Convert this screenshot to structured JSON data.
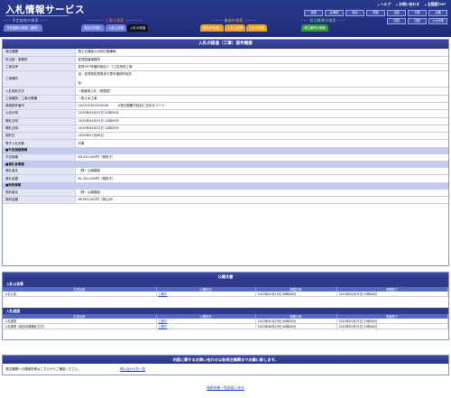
{
  "header": {
    "title": "入札情報サービス",
    "top_links": [
      "ヘルプ",
      "お問い合わせ",
      "全国版TOP"
    ],
    "regions_row1": [
      "全国",
      "北海道",
      "東北",
      "関東",
      "北陸",
      "中部",
      "近畿"
    ],
    "regions_row2": [
      "中国",
      "四国",
      "九州沖縄"
    ],
    "nav_groups": [
      {
        "label": "予定価格の検索",
        "tabs": [
          "予定価格の検索（通常）"
        ]
      },
      {
        "label": "工事の検索",
        "tabs": [
          "発注の見通し",
          "入札公告等",
          "入札の経過"
        ],
        "active": 2
      },
      {
        "label": "業務の検索",
        "tabs": [
          "発注の見通し",
          "入札公告等",
          "入札の経過"
        ]
      },
      {
        "label": "発注機関の検索",
        "tabs": [
          "発注機関の情報"
        ]
      }
    ]
  },
  "detail": {
    "title": "入札の経過（工事）案件概要",
    "rows": [
      {
        "label": "発注機関",
        "value": "国土交通省九州地方整備局"
      },
      {
        "label": "担当部・事務所",
        "value": "佐賀国道事務所"
      },
      {
        "label": "工事名称",
        "value": "佐賀497号福田地区5・7工区改良工事"
      },
      {
        "label": "工事場所",
        "value": "自：佐賀県佐賀県伊万里市福田町地先",
        "value2": "至："
      },
      {
        "label": "入札契約方式",
        "value": "一般競争入札（簡易型）"
      },
      {
        "label": "工事種別／工事の業種",
        "value": "一般土木工事"
      },
      {
        "label": "調達案件番号",
        "value": "202305300010006　　　※発注機関が独自に定めるコード"
      },
      {
        "label": "公告日時",
        "value": "2023年05月15日 07時30分"
      },
      {
        "label": "開札日時",
        "value": "2023年05月25日 12時00分"
      },
      {
        "label": "開札日時",
        "value": "2023年05月22日 14時33分"
      },
      {
        "label": "契約日",
        "value": "2023年07月06日"
      },
      {
        "label": "電子入札対象",
        "value": "対象"
      }
    ],
    "price_section": "■予定価格情報",
    "price_label": "予定価格",
    "price_value": "89,420,000円（税抜き）",
    "winner_section": "■落札者情報",
    "winner_label": "落札者名",
    "winner_value": "（株）山崎建設",
    "winner_amount_label": "落札金額",
    "winner_amount_value": "81,300,000円（税抜き）",
    "contract_section": "■契約情報",
    "contract_label": "契約者名",
    "contract_value": "（株）山崎建設",
    "contract_amount_label": "契約金額",
    "contract_amount_value": "89,050,000円（税込み）"
  },
  "attachments": {
    "title": "公開文書",
    "headers": [
      "文書名称",
      "公開状況",
      "掲載日時",
      "掲載終了"
    ],
    "group1_title": "入札公告等",
    "group1_rows": [
      {
        "name": "入札公告",
        "status": "公開中",
        "start": "2023年05月15日 08時00分",
        "end": "2023年05月31日 23時00分"
      }
    ],
    "group2_title": "入札経過",
    "group2_rows": [
      {
        "name": "入札調書",
        "status": "公開中",
        "start": "2023年05月29日 00時00分",
        "end": "2023年05月31日 23時00分"
      },
      {
        "name": "入札調書（総合評価落札方式）",
        "status": "公開中",
        "start": "2023年06月29日 00時00分",
        "end": "2023年05月31日 23時00分"
      }
    ]
  },
  "inquiry": {
    "title": "内容に関するお問い合わせは各発注機関までお願い致します。",
    "text": "発注機関への連絡先等はこちらからご確認ください。",
    "link": "問い合わせ先一覧"
  },
  "back_link": "検索結果一覧画面に戻る",
  "colors": {
    "header_bg": "#1e2c78",
    "label_bg": "#e3e6f4",
    "section_bg": "#c4cbec",
    "link": "#1a3cc0"
  }
}
